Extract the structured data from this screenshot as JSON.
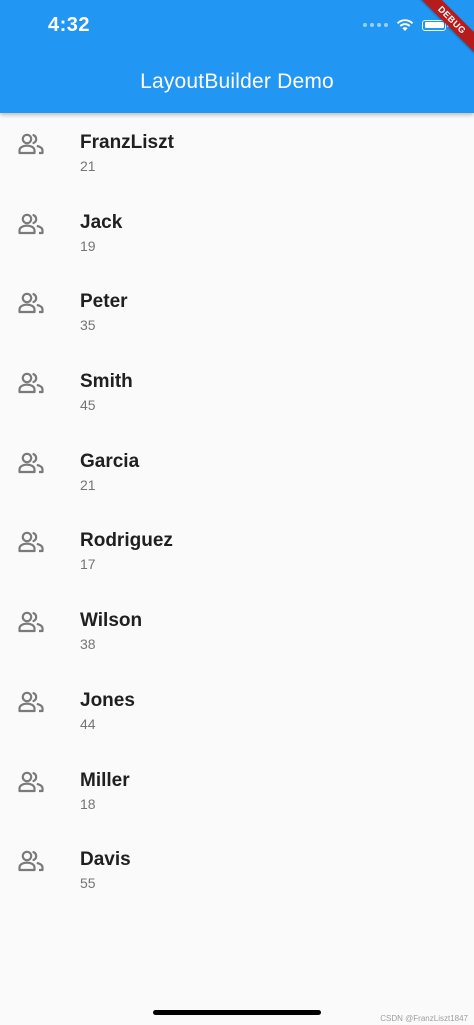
{
  "status_bar": {
    "time": "4:32",
    "icons": [
      "signal-icon",
      "wifi-icon",
      "battery-icon"
    ]
  },
  "app_bar": {
    "title": "LayoutBuilder Demo",
    "background_color": "#2196f3"
  },
  "debug_banner": {
    "label": "DEBUG",
    "color": "#b71c1c"
  },
  "people": [
    {
      "name": "FranzLiszt",
      "age": "21",
      "icon": "people-icon"
    },
    {
      "name": "Jack",
      "age": "19",
      "icon": "people-icon"
    },
    {
      "name": "Peter",
      "age": "35",
      "icon": "people-icon"
    },
    {
      "name": "Smith",
      "age": "45",
      "icon": "people-icon"
    },
    {
      "name": "Garcia",
      "age": "21",
      "icon": "people-icon"
    },
    {
      "name": "Rodriguez",
      "age": "17",
      "icon": "people-icon"
    },
    {
      "name": "Wilson",
      "age": "38",
      "icon": "people-icon"
    },
    {
      "name": "Jones",
      "age": "44",
      "icon": "people-icon"
    },
    {
      "name": "Miller",
      "age": "18",
      "icon": "people-icon"
    },
    {
      "name": "Davis",
      "age": "55",
      "icon": "people-icon"
    }
  ],
  "watermark": "CSDN @FranzLiszt1847"
}
